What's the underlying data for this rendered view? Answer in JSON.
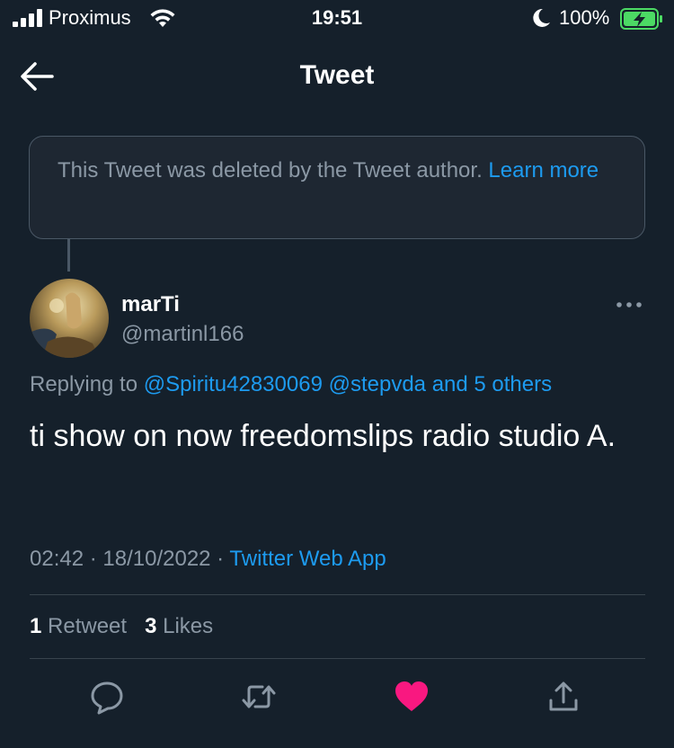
{
  "status_bar": {
    "carrier": "Proximus",
    "time": "19:51",
    "battery": "100%"
  },
  "header": {
    "title": "Tweet"
  },
  "deleted_notice": {
    "text": "This Tweet was deleted by the Tweet author. ",
    "link": "Learn more"
  },
  "tweet": {
    "display_name": "marTi",
    "handle": "@martinl166",
    "replying_prefix": "Replying to ",
    "mentions": [
      "@Spiritu42830069",
      "@stepvda",
      "and 5 others"
    ],
    "text": "ti show on now freedomslips radio studio A.",
    "time": "02:42",
    "date": "18/10/2022",
    "source": "Twitter Web App",
    "retweets": "1",
    "retweet_label": "Retweet",
    "likes": "3",
    "likes_label": "Likes"
  },
  "colors": {
    "background": "#15202b",
    "accent": "#1d9bf0",
    "muted": "#8b98a5",
    "like": "#f91880",
    "battery_charging": "#4cd964"
  },
  "icons": {
    "back": "arrow-left-icon",
    "more": "more-dots-icon",
    "reply": "reply-icon",
    "retweet": "retweet-icon",
    "like": "heart-icon",
    "share": "share-icon"
  }
}
